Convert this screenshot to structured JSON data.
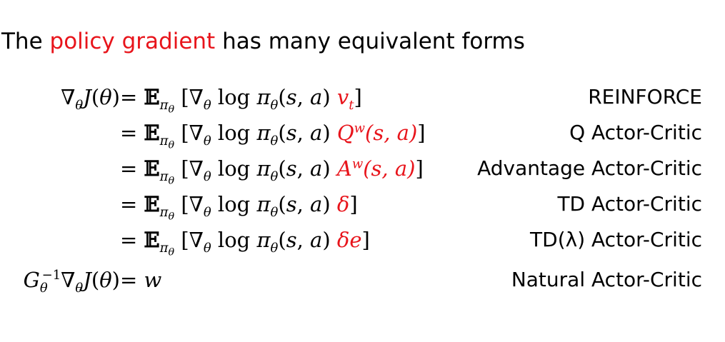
{
  "heading": {
    "prefix": "The ",
    "highlight": "policy gradient",
    "suffix": " has many equivalent forms"
  },
  "equations": [
    {
      "critic_term": "v",
      "critic_sub": "t",
      "critic_rest": "",
      "label": "REINFORCE"
    },
    {
      "critic_term": "Q",
      "critic_sup": "w",
      "critic_rest": "(s, a)",
      "label": "Q Actor-Critic"
    },
    {
      "critic_term": "A",
      "critic_sup": "w",
      "critic_rest": "(s, a)",
      "label": "Advantage Actor-Critic"
    },
    {
      "critic_term": "δ",
      "critic_rest": "",
      "label": "TD Actor-Critic"
    },
    {
      "critic_term": "δe",
      "critic_rest": "",
      "label": "TD(λ) Actor-Critic"
    }
  ],
  "natural": {
    "rhs": "= w",
    "label": "Natural Actor-Critic"
  },
  "colors": {
    "highlight": "#e8141b",
    "text": "#000000"
  }
}
